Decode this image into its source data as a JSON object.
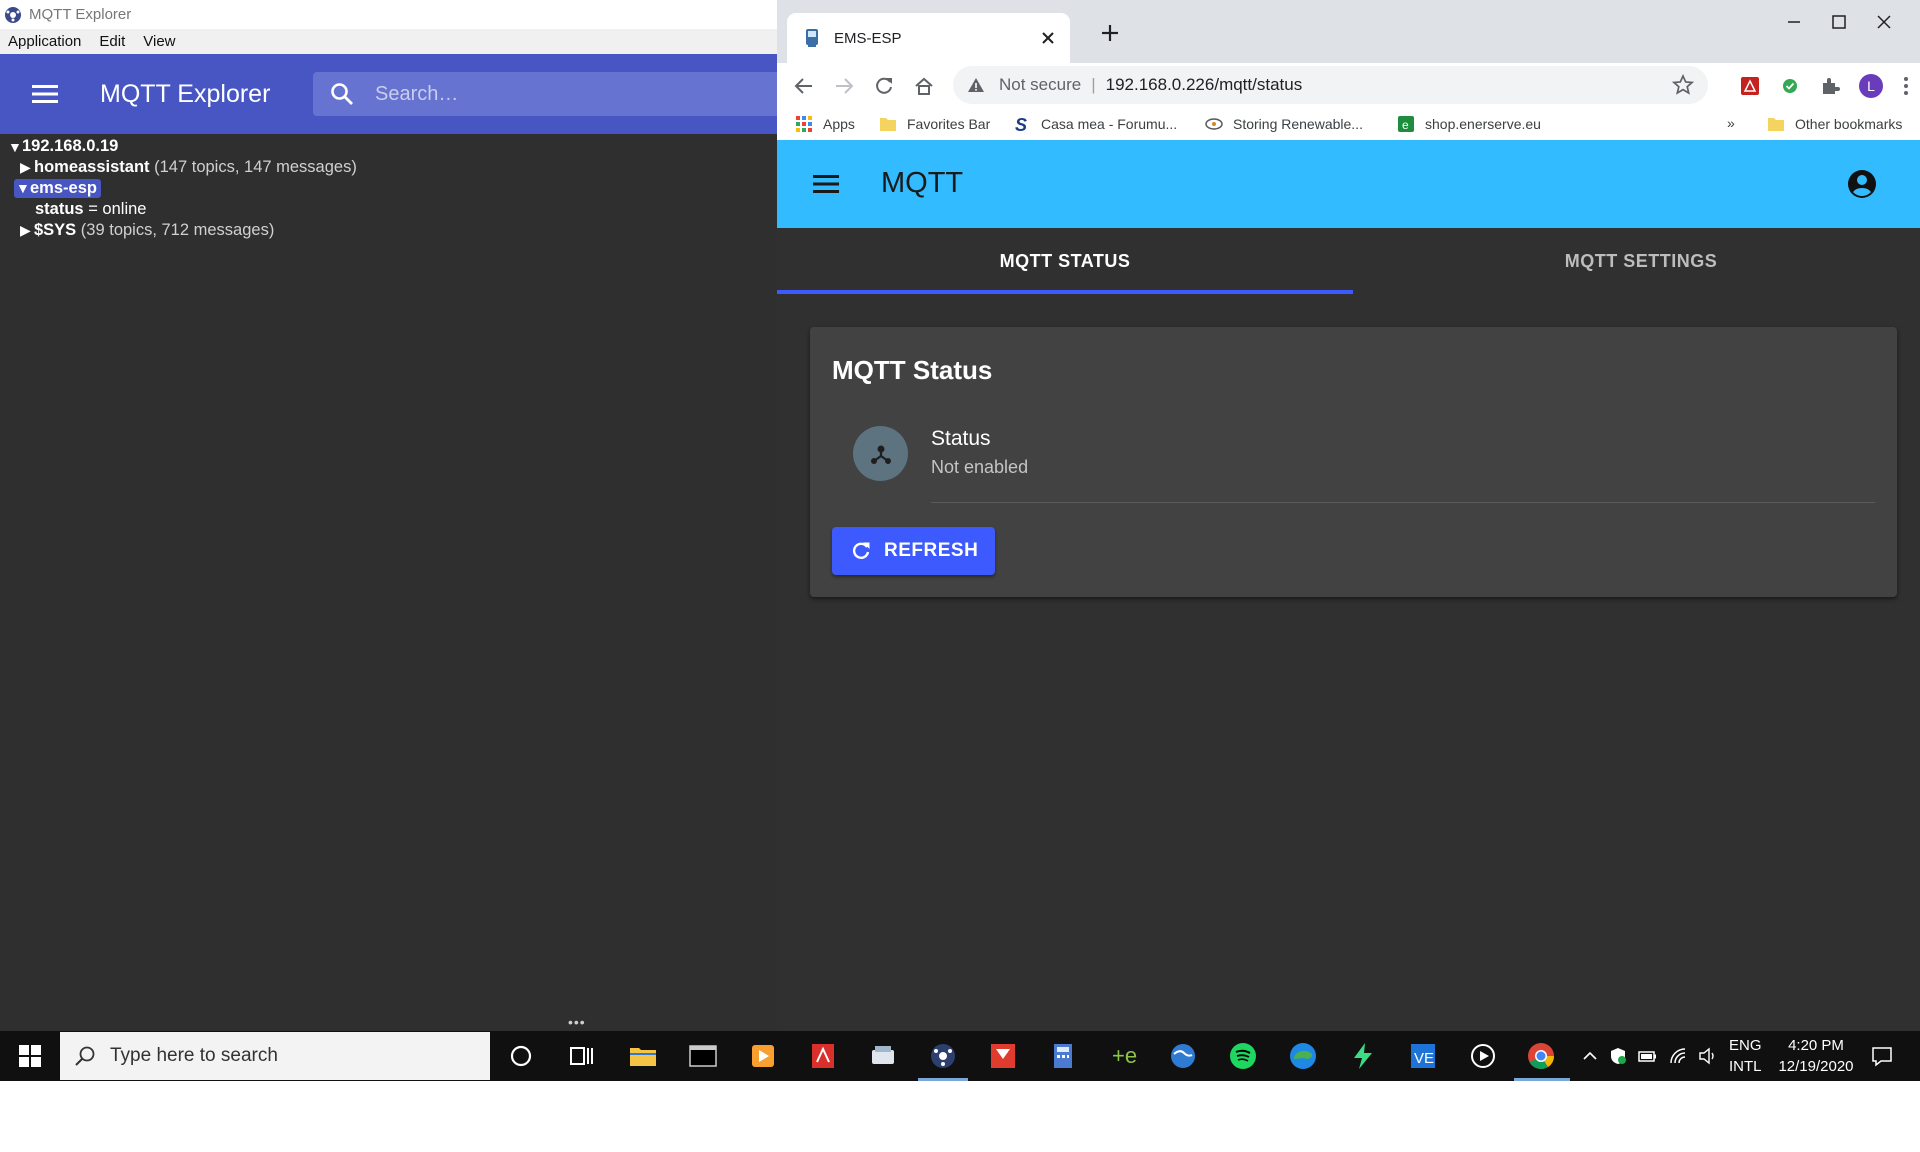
{
  "mqtt_explorer": {
    "window_title": "MQTT Explorer",
    "menu": [
      "Application",
      "Edit",
      "View"
    ],
    "app_title": "MQTT Explorer",
    "search_placeholder": "Search…",
    "tree": {
      "root": "192.168.0.19",
      "homeassistant": {
        "name": "homeassistant",
        "meta": "(147 topics, 147 messages)"
      },
      "ems_esp": {
        "name": "ems-esp"
      },
      "status": {
        "key": "status",
        "value": "= online"
      },
      "sys": {
        "name": "$SYS",
        "meta": "(39 topics, 712 messages)"
      }
    },
    "resize_handle": "•••"
  },
  "browser": {
    "tab_title": "EMS-ESP",
    "omnibox": {
      "security": "Not secure",
      "separator": "|",
      "url": "192.168.0.226/mqtt/status"
    },
    "profile_initial": "L",
    "bookmarks": [
      "Apps",
      "Favorites Bar",
      "Casa mea - Forumu...",
      "Storing Renewable...",
      "shop.enerserve.eu"
    ],
    "bookmarks_overflow": "»",
    "other_bookmarks": "Other bookmarks",
    "page": {
      "app_title": "MQTT",
      "tabs": [
        "MQTT STATUS",
        "MQTT SETTINGS"
      ],
      "card_title": "MQTT Status",
      "status_label": "Status",
      "status_value": "Not enabled",
      "refresh_label": "REFRESH"
    }
  },
  "taskbar": {
    "search_placeholder": "Type here to search",
    "lang_top": "ENG",
    "lang_bottom": "INTL",
    "time": "4:20 PM",
    "date": "12/19/2020"
  },
  "colors": {
    "mqtt_primary": "#4856c4",
    "ems_appbar": "#33bbff",
    "accent": "#3d5afe",
    "dark_bg": "#303030",
    "card_bg": "#424242"
  }
}
